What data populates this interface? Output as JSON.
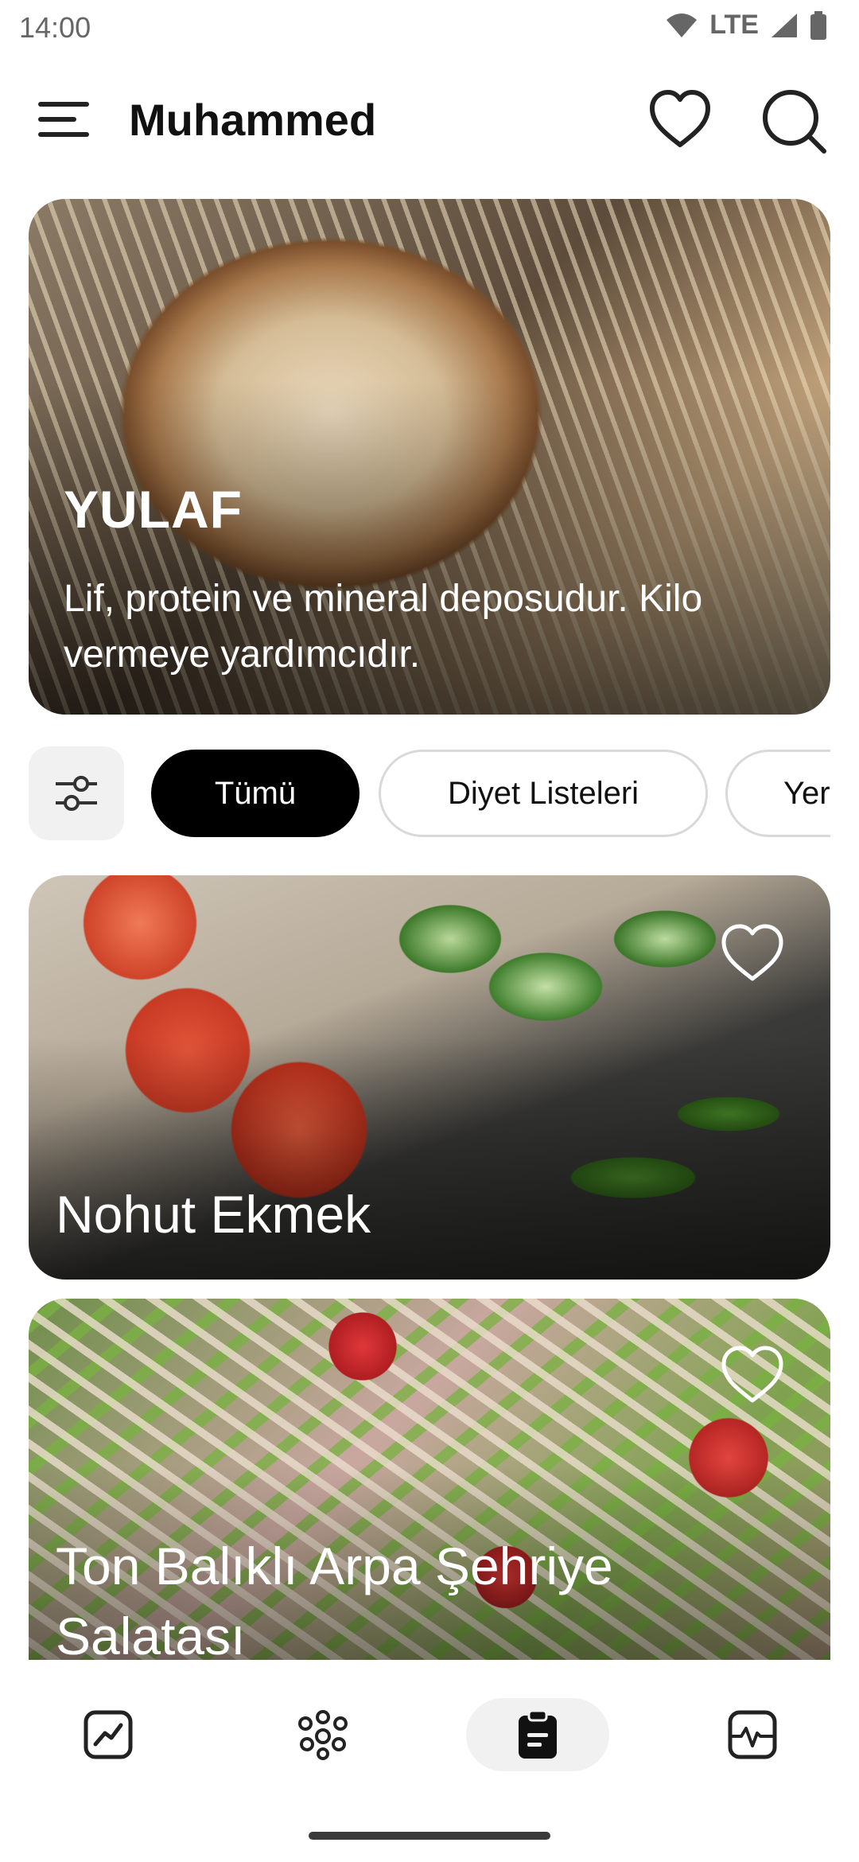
{
  "status_bar": {
    "time": "14:00",
    "network": "LTE"
  },
  "header": {
    "title": "Muhammed"
  },
  "hero": {
    "title": "YULAF",
    "subtitle": "Lif, protein ve mineral deposudur. Kilo vermeye yardımcıdır."
  },
  "filters": {
    "chips": [
      "Tümü",
      "Diyet Listeleri",
      "Yer"
    ],
    "selected": "Tümü"
  },
  "recipes": [
    {
      "title": "Nohut Ekmek"
    },
    {
      "title": "Ton Balıklı Arpa Şehriye Salatası"
    }
  ],
  "bottom_nav": {
    "items": [
      "chart-icon",
      "community-icon",
      "clipboard-icon",
      "activity-icon"
    ],
    "active_index": 2
  },
  "colors": {
    "accent": "#000000",
    "chip_border": "#d9d9d9",
    "surface": "#f1f1f1"
  }
}
